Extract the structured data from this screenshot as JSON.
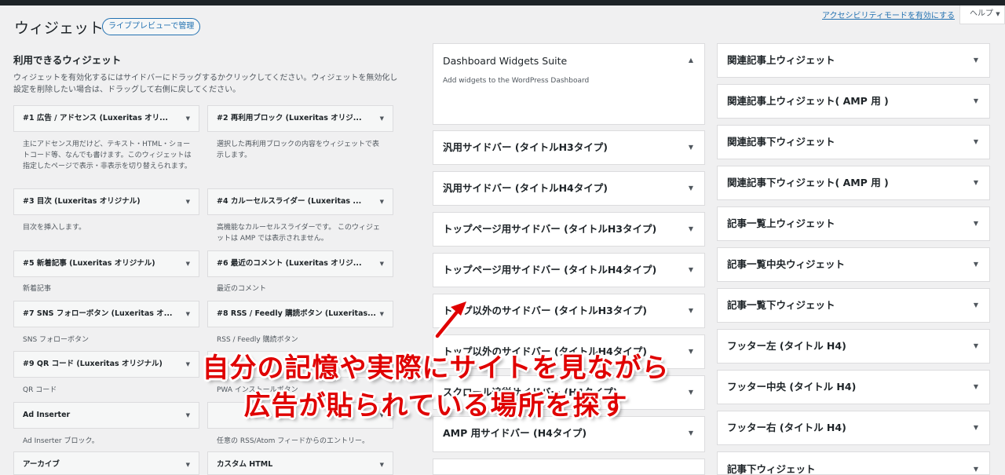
{
  "header": {
    "title": "ウィジェット",
    "live_preview_button": "ライブプレビューで管理",
    "a11y_link": "アクセシビリティモードを有効にする",
    "help_tab": "ヘルプ"
  },
  "available": {
    "heading": "利用できるウィジェット",
    "description": "ウィジェットを有効化するにはサイドバーにドラッグするかクリックしてください。ウィジェットを無効化し設定を削除したい場合は、ドラッグして右側に戻してください。",
    "widgets": [
      {
        "label": "#1 広告 / アドセンス (Luxeritas オリ...",
        "desc": "主にアドセンス用だけど、テキスト・HTML・ショートコード等、なんでも書けます。このウィジェットは指定したページで表示・非表示を切り替えられます。"
      },
      {
        "label": "#2 再利用ブロック (Luxeritas オリジ...",
        "desc": "選択した再利用ブロックの内容をウィジェットで表示します。"
      },
      {
        "label": "#3 目次 (Luxeritas オリジナル)",
        "desc": "目次を挿入します。"
      },
      {
        "label": "#4 カルーセルスライダー (Luxeritas ...",
        "desc": "高機能なカルーセルスライダーです。 このウィジェットは AMP では表示されません。"
      },
      {
        "label": "#5 新着記事 (Luxeritas オリジナル)",
        "desc": "新着記事"
      },
      {
        "label": "#6 最近のコメント (Luxeritas オリジ...",
        "desc": "最近のコメント"
      },
      {
        "label": "#7 SNS フォローボタン (Luxeritas オ...",
        "desc": "SNS フォローボタン"
      },
      {
        "label": "#8 RSS / Feedly 購読ボタン (Luxeritas...",
        "desc": "RSS / Feedly 購読ボタン"
      },
      {
        "label": "#9 QR コード (Luxeritas オリジナル)",
        "desc": "QR コード"
      },
      {
        "label": "",
        "desc": "PWA インストールボタン"
      },
      {
        "label": "Ad Inserter",
        "desc": "Ad Inserter ブロック。"
      },
      {
        "label": "",
        "desc": "任意の RSS/Atom フィードからのエントリー。"
      },
      {
        "label": "アーカイブ",
        "desc": ""
      },
      {
        "label": "カスタム HTML",
        "desc": ""
      }
    ]
  },
  "middle_areas": [
    {
      "label": "Dashboard Widgets Suite",
      "desc": "Add widgets to the WordPress Dashboard"
    },
    {
      "label": "汎用サイドバー (タイトルH3タイプ)"
    },
    {
      "label": "汎用サイドバー (タイトルH4タイプ)"
    },
    {
      "label": "トップページ用サイドバー (タイトルH3タイプ)"
    },
    {
      "label": "トップページ用サイドバー (タイトルH4タイプ)"
    },
    {
      "label": "トップ以外のサイドバー (タイトルH3タイプ)"
    },
    {
      "label": "トップ以外のサイドバー (タイトルH4タイプ)"
    },
    {
      "label": "スクロール追従サイドバー (H4タイプ)"
    },
    {
      "label": "AMP 用サイドバー (H4タイプ)"
    }
  ],
  "right_areas": [
    {
      "label": "関連記事上ウィジェット"
    },
    {
      "label": "関連記事上ウィジェット( AMP 用 )"
    },
    {
      "label": "関連記事下ウィジェット"
    },
    {
      "label": "関連記事下ウィジェット( AMP 用 )"
    },
    {
      "label": "記事一覧上ウィジェット"
    },
    {
      "label": "記事一覧中央ウィジェット"
    },
    {
      "label": "記事一覧下ウィジェット"
    },
    {
      "label": "フッター左 (タイトル H4)"
    },
    {
      "label": "フッター中央 (タイトル H4)"
    },
    {
      "label": "フッター右 (タイトル H4)"
    },
    {
      "label": "記事下ウィジェット"
    }
  ],
  "annotation": {
    "line1": "自分の記憶や実際にサイトを見ながら",
    "line2": "広告が貼られている場所を探す",
    "color": "#e00000"
  }
}
